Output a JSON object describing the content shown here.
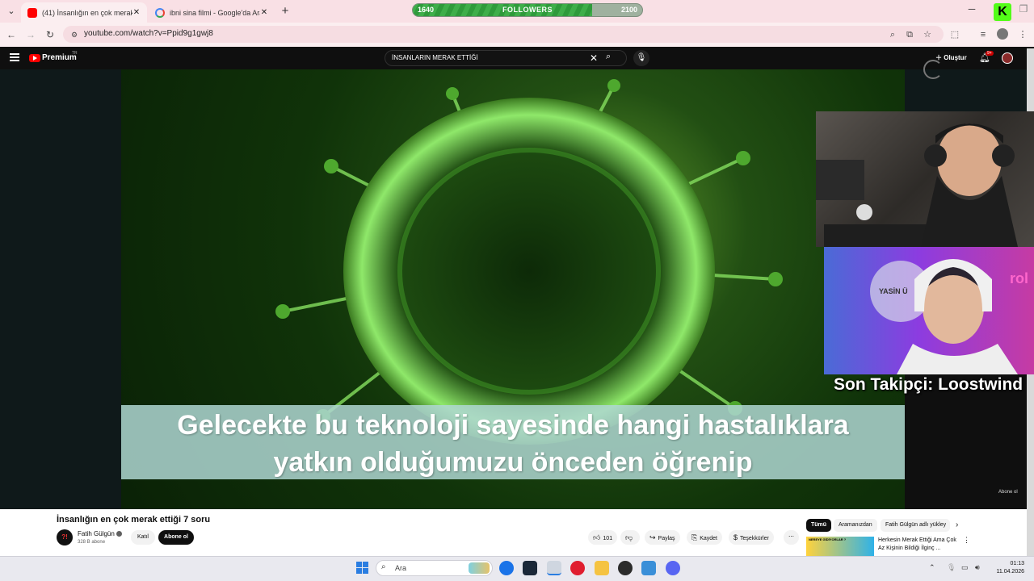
{
  "browser": {
    "tabs": [
      {
        "label": "(41) İnsanlığın en çok merak etti",
        "active": true
      },
      {
        "label": "ibni sina filmi - Google'da Ara",
        "active": false
      }
    ],
    "url": "youtube.com/watch?v=Ppid9g1gwj8"
  },
  "followers_overlay": {
    "start": "1640",
    "label": "FOLLOWERS",
    "goal": "2100",
    "progress": 0.78
  },
  "youtube": {
    "brand": "Premium",
    "country": "TR",
    "search_query": "İNSANLARIN MERAK ETTİĞİ",
    "create_label": "Oluştur",
    "notif_count": "9+"
  },
  "video": {
    "caption_line1": "Gelecekte bu teknoloji sayesinde hangi hastalıklara",
    "caption_line2": "yatkın olduğumuzu önceden öğrenip",
    "watermark": "Abone ol",
    "title": "İnsanlığın en çok merak ettiği 7 soru"
  },
  "channel": {
    "avatar_text": "?!",
    "name": "Fatih Gülgün",
    "subscribers": "328 B abone",
    "join_label": "Katıl",
    "subscribe_label": "Abone ol"
  },
  "actions": {
    "likes": "101",
    "share": "Paylaş",
    "save": "Kaydet",
    "thanks": "Teşekkürler"
  },
  "chips": [
    "Tümü",
    "Aramanızdan",
    "Fatih Gülgün adlı yükley"
  ],
  "recommended": {
    "thumb_text": "NEREYE GİDİYORLAR ?",
    "title": "Herkesin Merak Ettiği Ama Çok Az Kişinin Bildiği İlginç ..."
  },
  "stream_overlay": {
    "last_follower": "Son Takipçi: Loostwind"
  },
  "taskbar": {
    "search_placeholder": "Ara",
    "time": "01:13",
    "date": "11.04.2026"
  },
  "colors": {
    "yt_red": "#ff0000",
    "kick_green": "#53fc18",
    "browser_pink": "#f9e0e5"
  }
}
